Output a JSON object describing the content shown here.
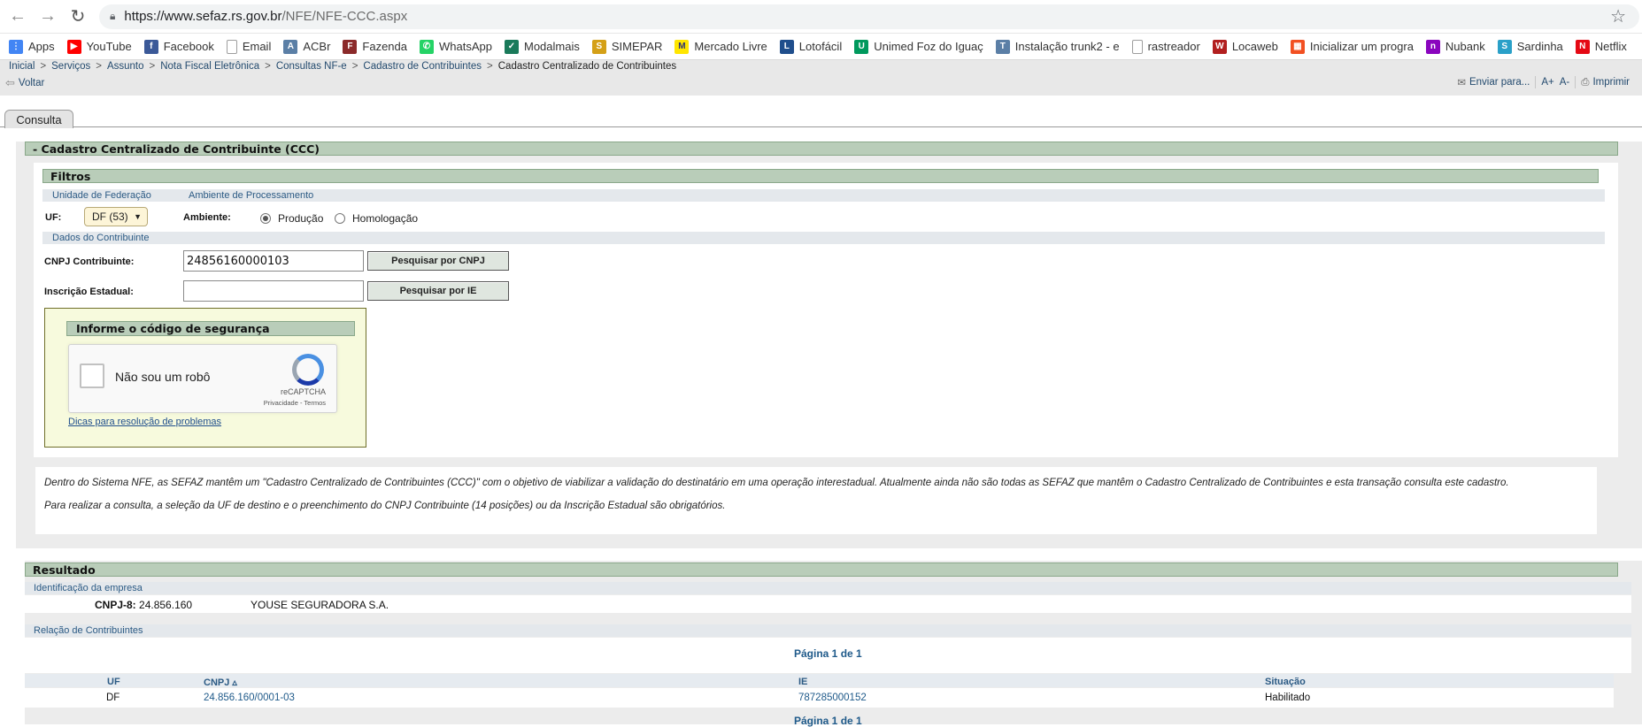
{
  "browser": {
    "url_host": "https://www.sefaz.rs.gov.br",
    "url_path": "/NFE/NFE-CCC.aspx"
  },
  "bookmarks": [
    {
      "label": "Apps",
      "icon": "apps-grid-icon",
      "color": "#4285f4"
    },
    {
      "label": "YouTube",
      "icon": "youtube-icon",
      "color": "#ff0000"
    },
    {
      "label": "Facebook",
      "icon": "facebook-icon",
      "color": "#3b5998"
    },
    {
      "label": "Email",
      "icon": "page-icon",
      "color": "#9e9e9e"
    },
    {
      "label": "ACBr",
      "icon": "acbr-icon",
      "color": "#5b7fa6"
    },
    {
      "label": "Fazenda",
      "icon": "fazenda-icon",
      "color": "#8b2a2a"
    },
    {
      "label": "WhatsApp",
      "icon": "whatsapp-icon",
      "color": "#25d366"
    },
    {
      "label": "Modalmais",
      "icon": "modalmais-icon",
      "color": "#1a7a5a"
    },
    {
      "label": "SIMEPAR",
      "icon": "simepar-icon",
      "color": "#d4a017"
    },
    {
      "label": "Mercado Livre",
      "icon": "mercadolivre-icon",
      "color": "#ffe600"
    },
    {
      "label": "Lotofácil",
      "icon": "lotofacil-icon",
      "color": "#1f4e8c"
    },
    {
      "label": "Unimed Foz do Iguaç",
      "icon": "unimed-icon",
      "color": "#00995d"
    },
    {
      "label": "Instalação trunk2 - e",
      "icon": "trunk-icon",
      "color": "#5b7fa6"
    },
    {
      "label": "rastreador",
      "icon": "page-icon",
      "color": "#9e9e9e"
    },
    {
      "label": "Locaweb",
      "icon": "locaweb-icon",
      "color": "#b21f1f"
    },
    {
      "label": "Inicializar um progra",
      "icon": "microsoft-icon",
      "color": "#f25022"
    },
    {
      "label": "Nubank",
      "icon": "nubank-icon",
      "color": "#8a05be"
    },
    {
      "label": "Sardinha",
      "icon": "sardinha-icon",
      "color": "#2aa0c8"
    },
    {
      "label": "Netflix",
      "icon": "netflix-icon",
      "color": "#e50914"
    }
  ],
  "breadcrumb": [
    "Inicial",
    "Serviços",
    "Assunto",
    "Nota Fiscal Eletrônica",
    "Consultas NF-e",
    "Cadastro de Contribuintes"
  ],
  "breadcrumb_current": "Cadastro Centralizado de Contribuintes",
  "toolbar": {
    "voltar": "Voltar",
    "enviar": "Enviar para...",
    "font_up": "A+",
    "font_down": "A-",
    "imprimir": "Imprimir"
  },
  "tab": "Consulta",
  "main_title": "- Cadastro Centralizado de Contribuinte (CCC)",
  "filtros": {
    "title": "Filtros",
    "uf_section": "Unidade de Federação",
    "amb_section": "Ambiente de Processamento",
    "uf_label": "UF:",
    "uf_value": "DF (53)",
    "amb_label": "Ambiente:",
    "opt_producao": "Produção",
    "opt_homologacao": "Homologação",
    "dados_section": "Dados do Contribuinte",
    "cnpj_label": "CNPJ Contribuinte:",
    "cnpj_value": "24856160000103",
    "btn_cnpj": "Pesquisar por CNPJ",
    "ie_label": "Inscrição Estadual:",
    "ie_value": "",
    "btn_ie": "Pesquisar por IE"
  },
  "captcha": {
    "title": "Informe o código de segurança",
    "label": "Não sou um robô",
    "brand": "reCAPTCHA",
    "terms": "Privacidade - Termos",
    "help": "Dicas para resolução de problemas"
  },
  "info": {
    "p1": "Dentro do Sistema NFE, as SEFAZ mantêm um \"Cadastro Centralizado de Contribuintes (CCC)\" com o objetivo de viabilizar a validação do destinatário em uma operação interestadual. Atualmente ainda não são todas as SEFAZ que mantêm o Cadastro Centralizado de Contribuintes e esta transação consulta este cadastro.",
    "p2": "Para realizar a consulta, a seleção da UF de destino e o preenchimento do CNPJ Contribuinte (14 posições) ou da Inscrição Estadual são obrigatórios."
  },
  "resultado": {
    "title": "Resultado",
    "id_section": "Identificação da empresa",
    "cnpj8_label": "CNPJ-8:",
    "cnpj8_value": "24.856.160",
    "razao": "YOUSE SEGURADORA S.A.",
    "rel_section": "Relação de Contribuintes",
    "page_top": "Página 1 de 1",
    "page_bottom": "Página 1 de 1",
    "columns": [
      "UF",
      "CNPJ ▵",
      "IE",
      "Situação"
    ],
    "rows": [
      {
        "uf": "DF",
        "cnpj": "24.856.160/0001-03",
        "ie": "787285000152",
        "situacao": "Habilitado"
      }
    ]
  }
}
